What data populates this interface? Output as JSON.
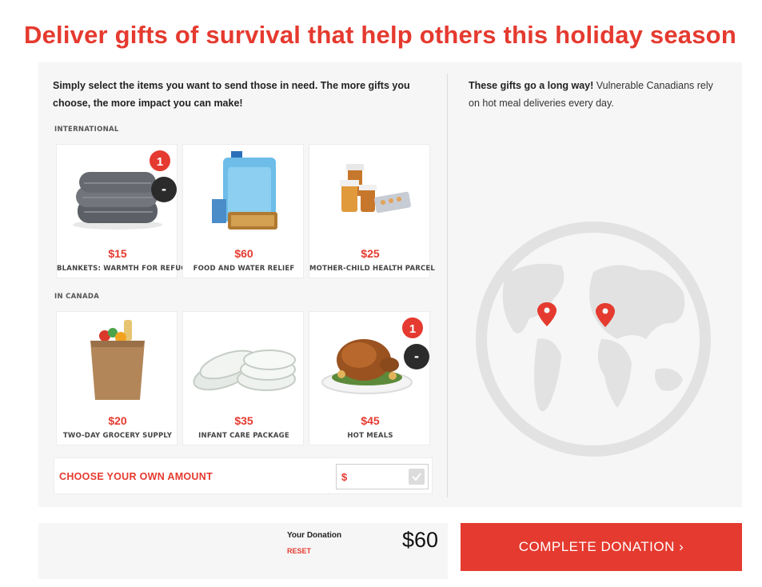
{
  "headline": "Deliver gifts of survival that help others this holiday season",
  "intro": "Simply select the items you want to send those in need. The more gifts you choose, the more impact you can make!",
  "sections": {
    "international": "INTERNATIONAL",
    "canada": "IN CANADA"
  },
  "gifts": {
    "international": [
      {
        "price": "$15",
        "name": "BLANKETS: WARMTH FOR REFUGEES",
        "count": "1",
        "icon": "blanket-icon"
      },
      {
        "price": "$60",
        "name": "FOOD AND WATER RELIEF",
        "icon": "water-jug-icon"
      },
      {
        "price": "$25",
        "name": "MOTHER-CHILD HEALTH PARCEL",
        "icon": "medicine-icon"
      }
    ],
    "canada": [
      {
        "price": "$20",
        "name": "TWO-DAY GROCERY SUPPLY",
        "icon": "grocery-bag-icon"
      },
      {
        "price": "$35",
        "name": "INFANT CARE PACKAGE",
        "icon": "diapers-icon"
      },
      {
        "price": "$45",
        "name": "HOT MEALS",
        "count": "1",
        "icon": "turkey-icon"
      }
    ]
  },
  "minus_symbol": "-",
  "own_amount": {
    "label": "CHOOSE YOUR OWN AMOUNT",
    "currency": "$"
  },
  "info": {
    "bold": "These gifts go a long way!",
    "text": " Vulnerable Canadians rely on hot meal deliveries every day."
  },
  "donation": {
    "label": "Your Donation",
    "reset": "RESET",
    "amount": "$60"
  },
  "complete_button": "COMPLETE DONATION ›",
  "colors": {
    "accent": "#e53a2f",
    "panel": "#f6f6f6",
    "globe": "#e2e2e2"
  }
}
